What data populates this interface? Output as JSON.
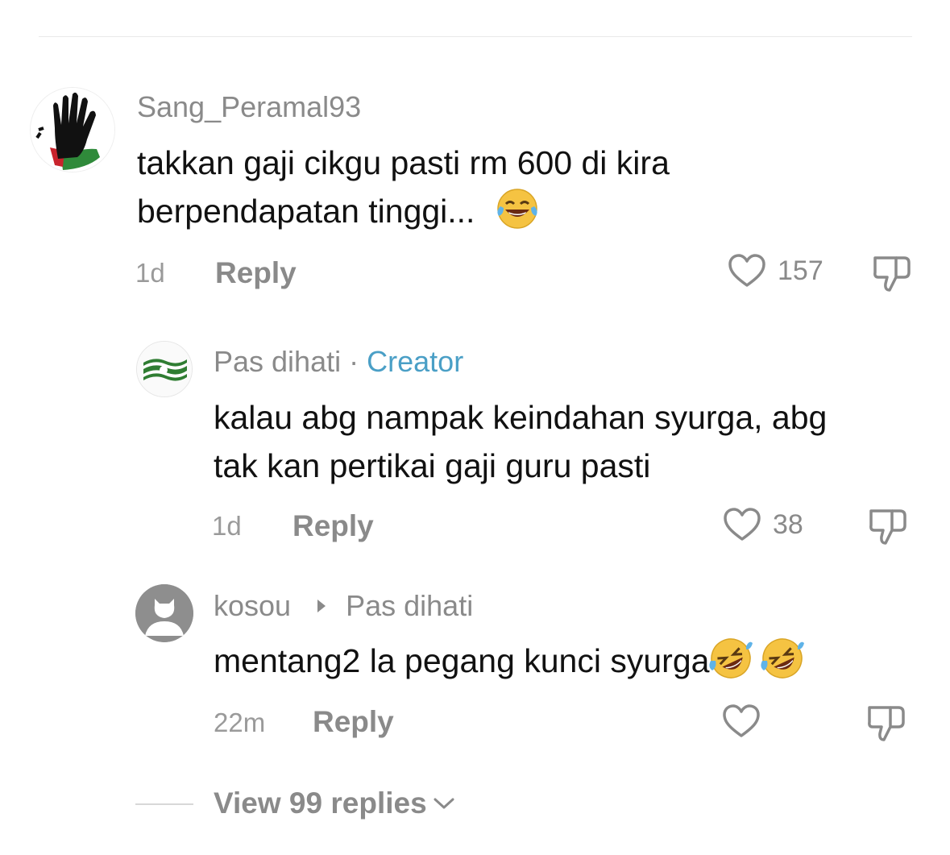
{
  "comments": [
    {
      "username": "Sang_Peramal93",
      "text_line1": "takkan gaji cikgu pasti rm 600 di kira",
      "text_line2": "berpendapatan tinggi...",
      "time": "1d",
      "reply_label": "Reply",
      "likes": "157",
      "emoji": "face-with-tears-of-joy"
    },
    {
      "username": "Pas dihati",
      "creator_sep": "·",
      "creator_label": "Creator",
      "text_line1": "kalau abg nampak keindahan syurga, abg",
      "text_line2": "tak kan pertikai gaji guru pasti",
      "time": "1d",
      "reply_label": "Reply",
      "likes": "38"
    },
    {
      "username": "kosou",
      "reply_to": "Pas dihati",
      "text": "mentang2 la pegang kunci syurga",
      "time": "22m",
      "reply_label": "Reply",
      "emoji": "rolling-on-the-floor-laughing"
    }
  ],
  "view_replies": "View 99 replies",
  "colors": {
    "muted": "#8a8a8a",
    "creator": "#4a9fc6",
    "text": "#111111"
  }
}
